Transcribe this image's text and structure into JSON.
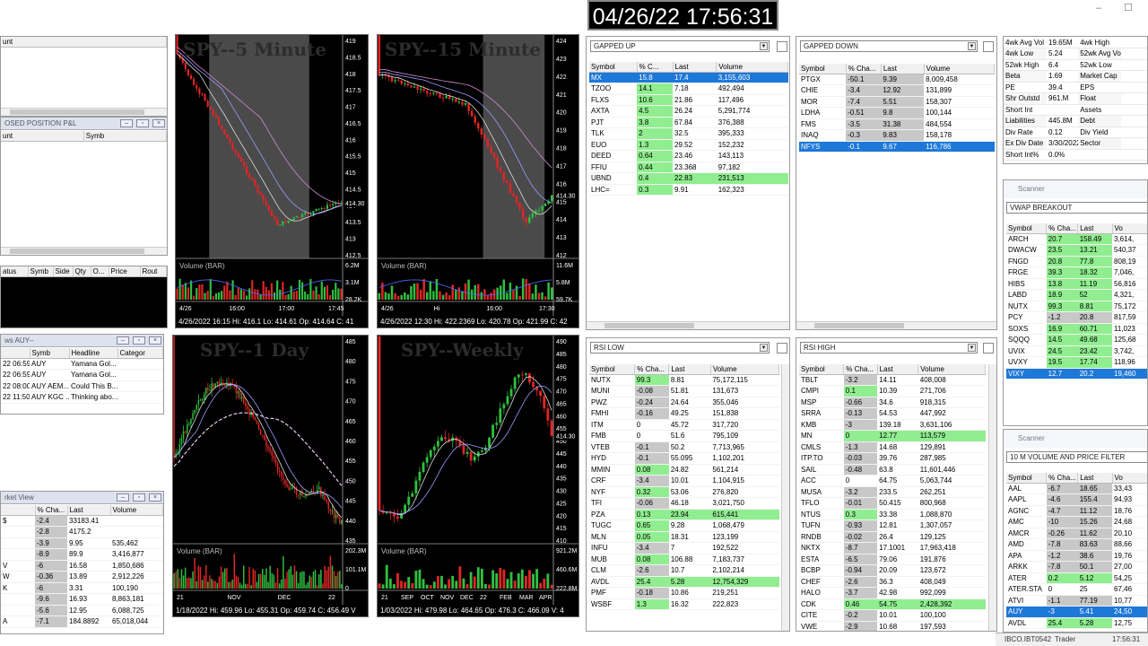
{
  "clock": "04/26/22 17:56:31",
  "status": {
    "left": "IBCO.IBT0542",
    "mid": "Trader",
    "right": "17:56:31"
  },
  "top_controls": {
    "minimize": "–",
    "maximize": "☐"
  },
  "left_panels": {
    "account": {
      "header": "unt"
    },
    "closed_pnl": {
      "title": "OSED POSITION P&L",
      "cols": [
        "unt",
        "Symb"
      ]
    },
    "orders": {
      "cols": [
        "atus",
        "Symb",
        "Side",
        "Qty",
        "O...",
        "Price",
        "Rout"
      ]
    },
    "news": {
      "title": "ws AUY--",
      "cols": [
        "",
        "Symb",
        "Headline",
        "Categor"
      ],
      "rows": [
        [
          "22 06:59",
          "AUY",
          "Yamana Gol...",
          ""
        ],
        [
          "22 06:59",
          "AUY",
          "Yamana Gol...",
          ""
        ],
        [
          "22 08:00",
          "AUY AEM...",
          "Could This B...",
          ""
        ],
        [
          "22 11:50",
          "AUY KGC ...",
          "Thinking abo...",
          ""
        ]
      ]
    },
    "market_view": {
      "title": "rket View",
      "cols": [
        "",
        "% Cha...",
        "Last",
        "Volume"
      ],
      "rows": [
        [
          "$",
          "-2.4",
          "33183.41",
          ""
        ],
        [
          "",
          "-2.8",
          "4175.2",
          ""
        ],
        [
          "",
          "-3.9",
          "9.95",
          "535,462"
        ],
        [
          "",
          "-8.9",
          "89.9",
          "3,416,877"
        ],
        [
          "V",
          "-6",
          "16.58",
          "1,850,686"
        ],
        [
          "W",
          "-0.36",
          "13.89",
          "2,912,226"
        ],
        [
          "K",
          "-6",
          "3.31",
          "100,190"
        ],
        [
          "",
          "-9.6",
          "16.93",
          "8,863,181"
        ],
        [
          "",
          "-5.6",
          "12.95",
          "6,088,725"
        ],
        [
          "A",
          "-7.1",
          "184.8892",
          "65,018,044"
        ]
      ]
    }
  },
  "charts": {
    "c5": {
      "title": "SPY--5 Minute",
      "vol_label": "Volume (BAR)",
      "ticks": [
        "419",
        "418.5",
        "418",
        "417.5",
        "417",
        "416.5",
        "416",
        "415.5",
        "415",
        "414.5",
        "414",
        "413.5",
        "413",
        "412.5"
      ],
      "last_tag": "414.30",
      "vol_ticks": [
        "6.2M",
        "3.1M",
        "28.2K"
      ],
      "xticks": [
        "4/26",
        "16:00",
        "17:00",
        "17:45"
      ],
      "footer": "4/26/2022 16:15   Hi: 416.1   Lo: 414.61   Op: 414.64   C: 41"
    },
    "c15": {
      "title": "SPY--15 Minute",
      "vol_label": "Volume (BAR)",
      "ticks": [
        "424",
        "423",
        "422",
        "421",
        "420",
        "419",
        "418",
        "417",
        "416",
        "415",
        "414",
        "413",
        "412"
      ],
      "last_tag": "414.30",
      "vol_ticks": [
        "11.6M",
        "5.8M",
        "59.7K"
      ],
      "xticks": [
        "4/26",
        "Hi",
        "16:00",
        "17:30"
      ],
      "footer": "4/26/2022 12:30   Hi: 422.2369   Lo: 420.78   Op: 421.99   C: 42"
    },
    "c1d": {
      "title": "SPY--1 Day",
      "vol_label": "Volume (BAR)",
      "ticks": [
        "485",
        "480",
        "475",
        "470",
        "465",
        "460",
        "455",
        "450",
        "445",
        "440",
        "435"
      ],
      "last_tag": "",
      "vol_ticks": [
        "202.3M",
        "101.1M",
        "0"
      ],
      "xticks": [
        "21",
        "NOV",
        "DEC",
        "22"
      ],
      "footer": "1/18/2022   Hi: 459.96   Lo: 455.31   Op: 459.74   C: 456.49   V"
    },
    "cw": {
      "title": "SPY--Weekly",
      "vol_label": "Volume (BAR)",
      "ticks": [
        "490",
        "485",
        "480",
        "475",
        "470",
        "465",
        "460",
        "455",
        "450",
        "445",
        "440",
        "435",
        "430",
        "425",
        "420",
        "415",
        "410"
      ],
      "last_tag": "414.30",
      "vol_ticks": [
        "921.2M",
        "460.6M",
        "222.8M"
      ],
      "xticks": [
        "21",
        "SEP",
        "OCT",
        "NOV",
        "DEC",
        "22",
        "FEB",
        "MAR",
        "APR"
      ],
      "footer": "1/03/2022   Hi: 479.98   Lo: 464.65   Op: 476.3   C: 466.09   V: 4"
    }
  },
  "gapped_up": {
    "title": "GAPPED UP",
    "cols": [
      "Symbol",
      "% C...",
      "Last",
      "Volume"
    ],
    "rows": [
      [
        "MX",
        "15.8",
        "17.4",
        "3,155,603"
      ],
      [
        "TZOO",
        "14.1",
        "7.18",
        "492,494"
      ],
      [
        "FLXS",
        "10.6",
        "21.86",
        "117,496"
      ],
      [
        "AXTA",
        "4.5",
        "26.24",
        "5,291,774"
      ],
      [
        "PJT",
        "3.8",
        "67.84",
        "376,388"
      ],
      [
        "TLK",
        "2",
        "32.5",
        "395,333"
      ],
      [
        "EUO",
        "1.3",
        "29.52",
        "152,232"
      ],
      [
        "DEED",
        "0.64",
        "23.46",
        "143,113"
      ],
      [
        "FFIU",
        "0.44",
        "23.368",
        "97,182"
      ],
      [
        "UBND",
        "0.4",
        "22.83",
        "231,513"
      ],
      [
        "LHC=",
        "0.3",
        "9.91",
        "162,323"
      ]
    ]
  },
  "gapped_down": {
    "title": "GAPPED DOWN",
    "cols": [
      "Symbol",
      "% Cha...",
      "Last",
      "Volume"
    ],
    "rows": [
      [
        "PTGX",
        "-50.1",
        "9.39",
        "8,009,458"
      ],
      [
        "CHIE",
        "-3.4",
        "12.92",
        "131,899"
      ],
      [
        "MOR",
        "-7.4",
        "5.51",
        "158,307"
      ],
      [
        "LDHA",
        "-0.51",
        "9.8",
        "100,144"
      ],
      [
        "FMS",
        "-3.5",
        "31.38",
        "484,554"
      ],
      [
        "INAQ",
        "-0.3",
        "9.83",
        "158,178"
      ],
      [
        "NFYS",
        "-0.1",
        "9.67",
        "116,786"
      ]
    ]
  },
  "rsi_low": {
    "title": "RSI LOW",
    "cols": [
      "Symbol",
      "% Cha...",
      "Last",
      "Volume"
    ],
    "rows": [
      [
        "NUTX",
        "99.3",
        "8.81",
        "75,172,115"
      ],
      [
        "MUNI",
        "-0.08",
        "51.81",
        "131,673"
      ],
      [
        "PWZ",
        "-0.24",
        "24.64",
        "355,046"
      ],
      [
        "FMHI",
        "-0.16",
        "49.25",
        "151,838"
      ],
      [
        "ITM",
        "0",
        "45.72",
        "317,720"
      ],
      [
        "FMB",
        "0",
        "51.6",
        "795,109"
      ],
      [
        "VTEB",
        "-0.1",
        "50.2",
        "7,713,965"
      ],
      [
        "HYD",
        "-0.1",
        "55.095",
        "1,102,201"
      ],
      [
        "MMIN",
        "0.08",
        "24.82",
        "561,214"
      ],
      [
        "CRF",
        "-3.4",
        "10.01",
        "1,104,915"
      ],
      [
        "NYF",
        "0.32",
        "53.06",
        "276,820"
      ],
      [
        "TFI",
        "-0.06",
        "46.18",
        "3,021,750"
      ],
      [
        "PZA",
        "0.13",
        "23.94",
        "615,441"
      ],
      [
        "TUGC",
        "0.65",
        "9.28",
        "1,068,479"
      ],
      [
        "MLN",
        "0.05",
        "18.31",
        "123,199"
      ],
      [
        "INFU",
        "-3.4",
        "7",
        "192,522"
      ],
      [
        "MUB",
        "0.08",
        "106.88",
        "7,183,737"
      ],
      [
        "CLM",
        "-2.6",
        "10.7",
        "2,102,214"
      ],
      [
        "AVDL",
        "25.4",
        "5.28",
        "12,754,329"
      ],
      [
        "PMF",
        "-0.18",
        "10.86",
        "219,251"
      ],
      [
        "WSBF",
        "1.3",
        "16.32",
        "222,823"
      ]
    ]
  },
  "rsi_high": {
    "title": "RSI HIGH",
    "cols": [
      "Symbol",
      "% Cha...",
      "Last",
      "Volume"
    ],
    "rows": [
      [
        "TBLT",
        "-3.2",
        "14.11",
        "408,008"
      ],
      [
        "CMPI",
        "0.1",
        "10.39",
        "271,706"
      ],
      [
        "MSP",
        "-0.66",
        "34.6",
        "918,315"
      ],
      [
        "SRRA",
        "-0.13",
        "54.53",
        "447,992"
      ],
      [
        "KMB",
        "-3",
        "139.18",
        "3,631,106"
      ],
      [
        "MN",
        "0",
        "12.77",
        "113,579"
      ],
      [
        "CMLS",
        "-1.3",
        "14.68",
        "129,891"
      ],
      [
        "ITP.TO",
        "-0.03",
        "39.76",
        "287,985"
      ],
      [
        "SAIL",
        "-0.48",
        "63.8",
        "11,601,446"
      ],
      [
        "ACC",
        "0",
        "64.75",
        "5,063,744"
      ],
      [
        "MUSA",
        "-3.2",
        "233.5",
        "262,251"
      ],
      [
        "TFLO",
        "-0.01",
        "50.415",
        "800,968"
      ],
      [
        "NTUS",
        "0.3",
        "33.38",
        "1,088,870"
      ],
      [
        "TUFN",
        "-0.93",
        "12.81",
        "1,307,057"
      ],
      [
        "RNDB",
        "-0.02",
        "26.4",
        "129,125"
      ],
      [
        "NKTX",
        "-8.7",
        "17.1001",
        "17,963,418"
      ],
      [
        "ESTA",
        "-6.5",
        "79.06",
        "191,876"
      ],
      [
        "BCBP",
        "-0.94",
        "20.09",
        "123,672"
      ],
      [
        "CHEF",
        "-2.6",
        "36.3",
        "408,049"
      ],
      [
        "HALO",
        "-3.7",
        "42.98",
        "992,099"
      ],
      [
        "CDK",
        "0.46",
        "54.75",
        "2,428,392"
      ],
      [
        "CITE",
        "-0.2",
        "10.01",
        "100,100"
      ],
      [
        "VWE",
        "-2.9",
        "10.68",
        "197,593"
      ]
    ]
  },
  "fundamentals": {
    "rows": [
      [
        "4wk Avg Vol",
        "19.65M",
        "4wk High",
        ""
      ],
      [
        "4wk Low",
        "5.24",
        "52wk Avg Vol",
        ""
      ],
      [
        "52wk High",
        "6.4",
        "52wk Low",
        ""
      ],
      [
        "Beta",
        "1.69",
        "Market Cap",
        ""
      ],
      [
        "PE",
        "39.4",
        "EPS",
        ""
      ],
      [
        "Shr Outstd",
        "961.M",
        "Float",
        ""
      ],
      [
        "Short Int",
        "",
        "Assets",
        ""
      ],
      [
        "Liabilities",
        "445.8M",
        "Debt",
        ""
      ],
      [
        "Div Rate",
        "0.12",
        "Div Yield",
        ""
      ],
      [
        "Ex Div Date",
        "3/30/2022",
        "Sector",
        ""
      ],
      [
        "Short Int%",
        "0.0%",
        "",
        ""
      ]
    ]
  },
  "vwap": {
    "scanner": "Scanner",
    "title": "VWAP BREAKOUT",
    "cols": [
      "Symbol",
      "% Cha...",
      "Last",
      "Vo"
    ],
    "rows": [
      [
        "ARCH",
        "20.7",
        "158.49",
        "3,614,"
      ],
      [
        "DWACW",
        "23.5",
        "13.21",
        "540,37"
      ],
      [
        "FNGD",
        "20.8",
        "77.8",
        "808,19"
      ],
      [
        "FRGE",
        "39.3",
        "18.32",
        "7,046,"
      ],
      [
        "HIBS",
        "13.8",
        "11.19",
        "56,816"
      ],
      [
        "LABD",
        "18.9",
        "52",
        "4,321,"
      ],
      [
        "NUTX",
        "99.3",
        "8.81",
        "75,172"
      ],
      [
        "PCY",
        "-1.2",
        "20.8",
        "817,59"
      ],
      [
        "SOXS",
        "16.9",
        "60.71",
        "11,023"
      ],
      [
        "SQQQ",
        "14.5",
        "49.68",
        "125,68"
      ],
      [
        "UVIX",
        "24.5",
        "23.42",
        "3,742,"
      ],
      [
        "UVXY",
        "19.5",
        "17.74",
        "118,96"
      ],
      [
        "VIXY",
        "12.7",
        "20.2",
        "19,460"
      ]
    ]
  },
  "tenm": {
    "scanner": "Scanner",
    "title": "10 M VOLUME AND PRICE FILTER",
    "cols": [
      "Symbol",
      "% Cha...",
      "Last",
      "Vo"
    ],
    "rows": [
      [
        "AAL",
        "-6.7",
        "18.65",
        "33,43"
      ],
      [
        "AAPL",
        "-4.6",
        "155.4",
        "94,93"
      ],
      [
        "AGNC",
        "-4.7",
        "11.12",
        "18,76"
      ],
      [
        "AMC",
        "-10",
        "15.26",
        "24,68"
      ],
      [
        "AMCR",
        "-0.26",
        "11.62",
        "20,10"
      ],
      [
        "AMD",
        "-7.8",
        "83.63",
        "88,66"
      ],
      [
        "APA",
        "-1.2",
        "38.6",
        "19,76"
      ],
      [
        "ARKK",
        "-7.8",
        "50.1",
        "27,00"
      ],
      [
        "ATER",
        "0.2",
        "5.12",
        "54,25"
      ],
      [
        "ATER.STA",
        "0",
        "25",
        "67,46"
      ],
      [
        "ATVI",
        "-1.1",
        "77.19",
        "10,77"
      ],
      [
        "AUY",
        "-3",
        "5.41",
        "24,50"
      ],
      [
        "AVDL",
        "25.4",
        "5.28",
        "12,75"
      ]
    ]
  }
}
